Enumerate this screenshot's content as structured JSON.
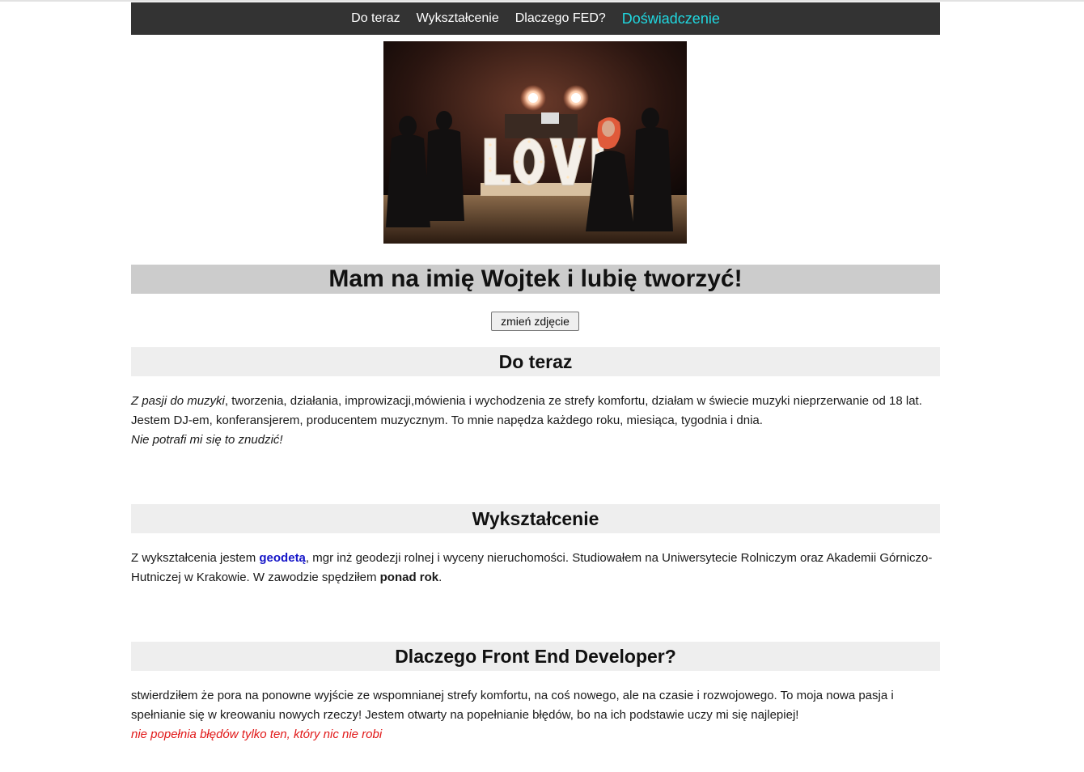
{
  "nav": {
    "items": [
      {
        "label": "Do teraz"
      },
      {
        "label": "Wykształcenie"
      },
      {
        "label": "Dlaczego FED?"
      },
      {
        "label": "Doświadczenie"
      }
    ]
  },
  "hero": {
    "photo_icon": "photo-dj-stage-love-letters",
    "title": "Mam na imię Wojtek i lubię tworzyć!",
    "change_button": "zmień zdjęcie"
  },
  "sections": {
    "do_teraz": {
      "title": "Do teraz",
      "italic_intro": "Z pasji do muzyki",
      "text": ", tworzenia, działania, improwizacji,mówienia i wychodzenia ze strefy komfortu, działam w świecie muzyki nieprzerwanie od 18 lat. Jestem DJ-em, konferansjerem, producentem muzycznym. To mnie napędza każdego roku, miesiąca, tygodnia i dnia.",
      "italic_outro": "Nie potrafi mi się to znudzić!"
    },
    "wyksztalcenie": {
      "title": "Wykształcenie",
      "text_before": "Z wykształcenia jestem ",
      "highlight": "geodetą",
      "text_middle": ", mgr inż geodezji rolnej i wyceny nieruchomości. Studiowałem na Uniwersytecie Rolniczym oraz Akademii Górniczo-Hutniczej w Krakowie. W zawodzie spędziłem ",
      "bold": "ponad rok",
      "text_after": "."
    },
    "dlaczego": {
      "title": "Dlaczego Front End Developer?",
      "text": "stwierdziłem że pora na ponowne wyjście ze wspomnianej strefy komfortu, na coś nowego, ale na czasie i rozwojowego. To moja nowa pasja i spełnianie się w kreowaniu nowych rzeczy! Jestem otwarty na popełnianie błędów, bo na ich podstawie uczy mi się najlepiej!",
      "quote": "nie popełnia błędów tylko ten, który nic nie robi"
    }
  },
  "colors": {
    "nav_bg": "#333333",
    "nav_active": "#20d8e0",
    "hero_bg": "#cccccc",
    "section_bg": "#eeeeee",
    "link_blue": "#1515c8",
    "quote_red": "#e11919"
  }
}
